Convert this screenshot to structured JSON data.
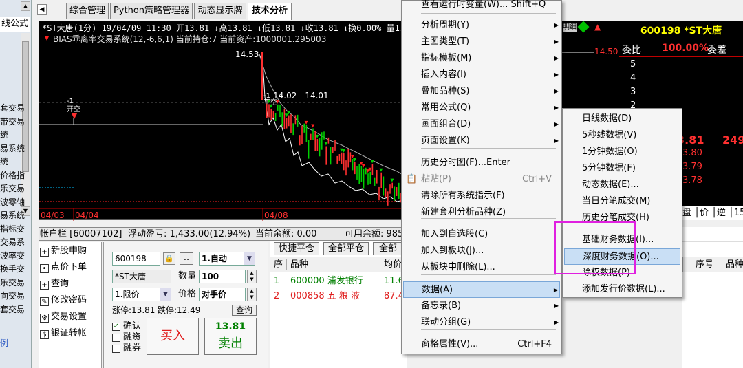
{
  "left_nav": {
    "header": "线公式",
    "items": [
      "套交易",
      "带交易",
      "统",
      "易系统",
      "统",
      "价格指",
      "乐交易",
      "波零轴",
      "易系统",
      "指标交",
      "交易系",
      "波率交",
      "换手交",
      "乐交易",
      "向交易",
      "套交易",
      "例"
    ]
  },
  "tabs": {
    "prev": "◀",
    "items": [
      "综合管理",
      "Python策略管理器",
      "动态显示牌",
      "技术分析"
    ],
    "active": 3
  },
  "chart": {
    "info_line": "*ST大唐(1分) 19/04/09 11:30 开13.81 ↓高13.81 ↓低13.81 ↓收13.81 ↓换0.00% 量17",
    "indicator_line": "BIAS乖离率交易系统(12,-6,6,1) 当前持仓:7 当前资产:1000001.295003",
    "price_top": "14.53",
    "price_mid": "14.02 - 14.01",
    "right_price": "14.50",
    "signal_open": "开空",
    "signal_minus1": "-1",
    "signal_minus1b": "-1",
    "signal_ping": "平空",
    "dates": [
      "04/03",
      "04/04",
      "04/08"
    ]
  },
  "quote_panel": {
    "code_name": "600198 *ST大唐",
    "weibi_label": "委比",
    "weibi_value": "100.00%",
    "weicha_label": "委差",
    "levels": [
      "5",
      "4",
      "3",
      "2",
      "1"
    ],
    "price_a": "3.81",
    "vol_a": "249",
    "price_b": "3.80",
    "price_c": "3.79",
    "price_d": "3.78",
    "bottom_tabs": "盘 │价 │逆 │15",
    "top_tag": "明细"
  },
  "account_bar": {
    "account": "帐户栏 [60007102]",
    "float_pnl": "浮动盈亏: 1,433.00(12.94%)",
    "current_amount": "当前余额: 0.00",
    "available": "可用余额: 985,050",
    "tail": "指",
    "btn_tong": "统",
    "btn_xiang": "详"
  },
  "trade_menu": {
    "items": [
      {
        "icon": "+",
        "label": "新股申购"
      },
      {
        "icon": "•",
        "label": "点价下单"
      },
      {
        "icon": "+",
        "label": "查询"
      },
      {
        "icon": "✎",
        "label": "修改密码"
      },
      {
        "icon": "⚙",
        "label": "交易设置"
      },
      {
        "icon": "$",
        "label": "银证转帐"
      }
    ]
  },
  "order_form": {
    "code": "600198",
    "dots": "..",
    "mode": "1.自动",
    "name": "*ST大唐",
    "qty_label": "数量",
    "qty": "100",
    "price_type": "1.限价",
    "price_label": "价格",
    "price_value": "对手价",
    "limit_up": "涨停:13.81",
    "limit_down": "跌停:12.49",
    "query_btn": "查询",
    "confirm": "确认",
    "margin": "融资",
    "short": "融券",
    "buy": "买入",
    "sell_price": "13.81",
    "sell": "卖出"
  },
  "positions": {
    "btn_quick": "快捷平仓",
    "btn_all": "全部平仓",
    "btn_all2": "全部",
    "headers": [
      "序",
      "品种",
      "均价"
    ],
    "rows": [
      {
        "idx": "1",
        "name": "600000 浦发银行",
        "price": "11.6"
      },
      {
        "idx": "2",
        "name": "000858 五 粮 液",
        "price": "87.4"
      }
    ]
  },
  "context_menu": {
    "top_partial": "查看运行时变量(W)... Shift+Q",
    "items": [
      {
        "label": "分析周期(Y)",
        "arrow": true
      },
      {
        "label": "主图类型(T)",
        "arrow": true
      },
      {
        "label": "指标模板(M)",
        "arrow": true
      },
      {
        "label": "插入内容(I)",
        "arrow": true
      },
      {
        "label": "叠加品种(S)",
        "arrow": true
      },
      {
        "label": "常用公式(Q)",
        "arrow": true
      },
      {
        "label": "画面组合(D)",
        "arrow": true
      },
      {
        "label": "页面设置(K)",
        "arrow": true
      },
      {
        "label": "历史分时图(F)...Enter",
        "arrow": false
      },
      {
        "label": "粘贴(P)",
        "shortcut": "Ctrl+V",
        "arrow": false,
        "disabled": true
      },
      {
        "label": "清除所有系统指示(F)",
        "arrow": false
      },
      {
        "label": "新建套利分析品种(Z)",
        "arrow": false
      },
      {
        "label": "加入到自选股(C)",
        "arrow": false
      },
      {
        "label": "加入到板块(J)...",
        "arrow": false
      },
      {
        "label": "从板块中删除(L)...",
        "arrow": false
      },
      {
        "label": "数据(A)",
        "arrow": true,
        "active": true
      },
      {
        "label": "备忘录(B)",
        "arrow": true
      },
      {
        "label": "联动分组(G)",
        "arrow": true
      },
      {
        "label": "窗格属性(V)...",
        "shortcut": "Ctrl+F4",
        "arrow": false
      }
    ]
  },
  "data_submenu": {
    "items": [
      {
        "label": "日线数据(D)"
      },
      {
        "label": "5秒线数据(V)"
      },
      {
        "label": "1分钟数据(O)"
      },
      {
        "label": "5分钟数据(F)"
      },
      {
        "label": "动态数据(E)..."
      },
      {
        "label": "当日分笔成交(M)"
      },
      {
        "label": "历史分笔成交(H)"
      },
      {
        "label": "基础财务数据(I)..."
      },
      {
        "label": "深度财务数据(O)...",
        "highlighted": true
      },
      {
        "label": "除权数据(P)"
      },
      {
        "label": "添加发行价数据(L)..."
      }
    ]
  },
  "far_right": {
    "col1": "序号",
    "col2": "品种"
  },
  "colors": {
    "highlight_box": "#e020e0",
    "menu_active": "#c9dff5",
    "red": "#ff2020",
    "green": "#00d000",
    "yellow": "#ffff00"
  }
}
